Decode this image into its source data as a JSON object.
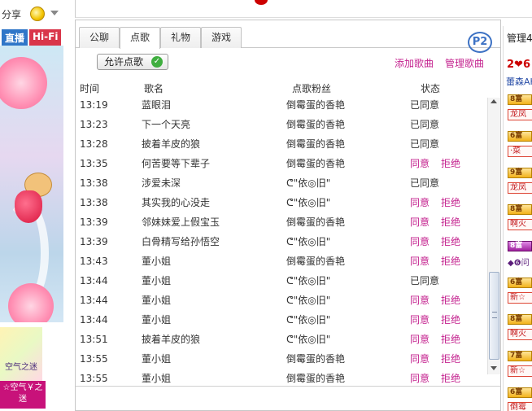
{
  "topbar": {
    "share_label": "分享"
  },
  "left_ad": {
    "live_label": "直播",
    "hifi_label": "Hi-Fi",
    "small_text": "空气之迷",
    "caption": "☆空气￥之迷"
  },
  "tabs": [
    {
      "label": "公聊"
    },
    {
      "label": "点歌"
    },
    {
      "label": "礼物"
    },
    {
      "label": "游戏"
    }
  ],
  "p2_badge": "P2",
  "controls": {
    "allow_button": "允许点歌",
    "add_song": "添加歌曲",
    "manage_song": "管理歌曲"
  },
  "columns": {
    "time": "时间",
    "song": "歌名",
    "fan": "点歌粉丝",
    "status": "状态"
  },
  "requests": [
    {
      "time": "13:19",
      "song": "蓝眼泪",
      "fan": "倒霉蛋的香艳",
      "status": "已同意",
      "reject": ""
    },
    {
      "time": "13:23",
      "song": "下一个天亮",
      "fan": "倒霉蛋的香艳",
      "status": "已同意",
      "reject": ""
    },
    {
      "time": "13:28",
      "song": "披着羊皮的狼",
      "fan": "倒霉蛋的香艳",
      "status": "已同意",
      "reject": ""
    },
    {
      "time": "13:35",
      "song": "何苦要等下辈子",
      "fan": "倒霉蛋的香艳",
      "status": "同意",
      "reject": "拒绝"
    },
    {
      "time": "13:38",
      "song": "涉爱未深",
      "fan": "ᕦ\"依◎旧\"",
      "status": "已同意",
      "reject": ""
    },
    {
      "time": "13:38",
      "song": "其实我的心没走",
      "fan": "ᕦ\"依◎旧\"",
      "status": "同意",
      "reject": "拒绝"
    },
    {
      "time": "13:39",
      "song": "邻妹妹爱上假宝玉",
      "fan": "倒霉蛋的香艳",
      "status": "同意",
      "reject": "拒绝"
    },
    {
      "time": "13:39",
      "song": "白骨精写给孙悟空",
      "fan": "ᕦ\"依◎旧\"",
      "status": "同意",
      "reject": "拒绝"
    },
    {
      "time": "13:43",
      "song": "董小姐",
      "fan": "倒霉蛋的香艳",
      "status": "同意",
      "reject": "拒绝"
    },
    {
      "time": "13:44",
      "song": "董小姐",
      "fan": "ᕦ\"依◎旧\"",
      "status": "已同意",
      "reject": ""
    },
    {
      "time": "13:44",
      "song": "董小姐",
      "fan": "ᕦ\"依◎旧\"",
      "status": "同意",
      "reject": "拒绝"
    },
    {
      "time": "13:44",
      "song": "董小姐",
      "fan": "ᕦ\"依◎旧\"",
      "status": "同意",
      "reject": "拒绝"
    },
    {
      "time": "13:51",
      "song": "披着羊皮的狼",
      "fan": "ᕦ\"依◎旧\"",
      "status": "同意",
      "reject": "拒绝"
    },
    {
      "time": "13:55",
      "song": "董小姐",
      "fan": "倒霉蛋的香艳",
      "status": "同意",
      "reject": "拒绝"
    },
    {
      "time": "13:55",
      "song": "董小姐",
      "fan": "倒霉蛋的香艳",
      "status": "同意",
      "reject": "拒绝"
    }
  ],
  "admin": {
    "title": "管理4",
    "hearts": "2❤6",
    "user": "蕾森AK",
    "items": [
      {
        "badge": "8富",
        "name": "龙凤",
        "purple": false
      },
      {
        "badge": "6富",
        "name": "·菜",
        "purple": false
      },
      {
        "badge": "9富",
        "name": "龙凤",
        "purple": false
      },
      {
        "badge": "8富",
        "name": "啊火",
        "purple": false
      },
      {
        "badge": "8富",
        "name": "",
        "extra": "◆❻问",
        "purple": true
      },
      {
        "badge": "6富",
        "name": "新☆",
        "purple": false
      },
      {
        "badge": "8富",
        "name": "啊火",
        "purple": false
      },
      {
        "badge": "7富",
        "name": "新☆",
        "purple": false
      },
      {
        "badge": "6富",
        "name": "倒霉",
        "purple": false
      }
    ]
  },
  "colors": {
    "link": "#c4238f",
    "accent_blue": "#3d72c4",
    "live_blue": "#2f76c8",
    "hifi_red": "#d9364a"
  }
}
